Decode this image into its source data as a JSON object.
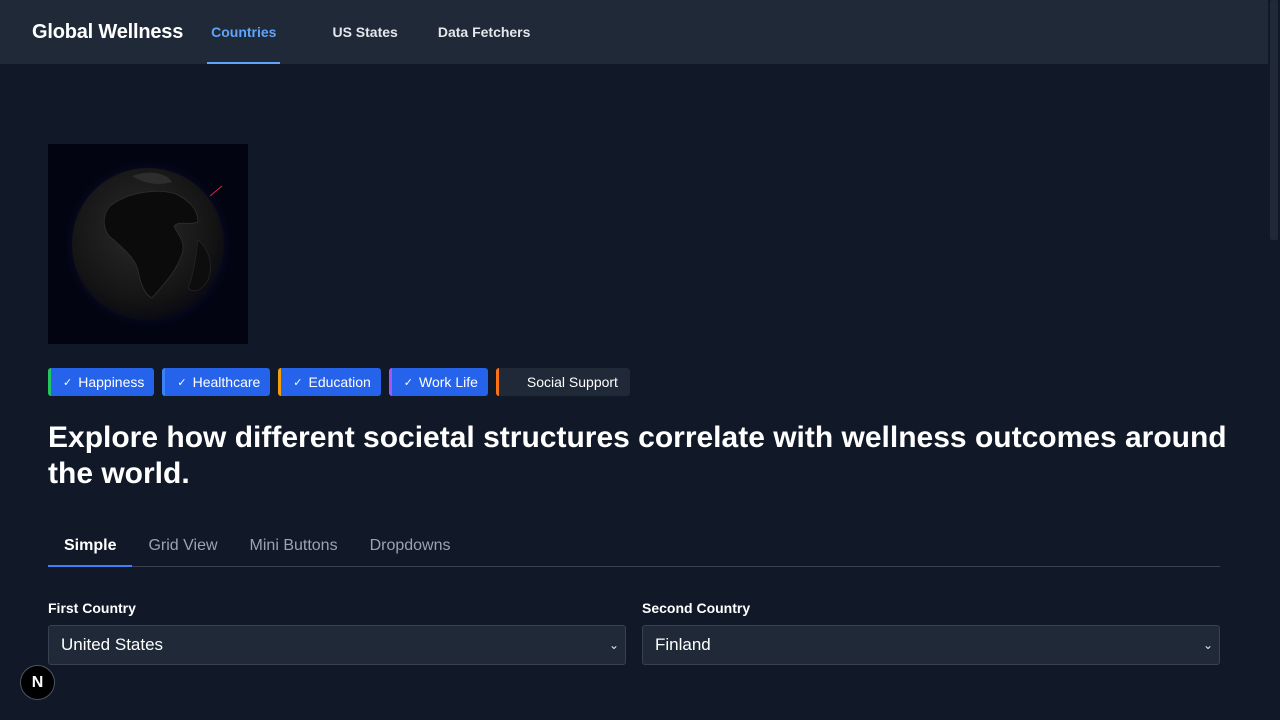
{
  "header": {
    "brand": "Global Wellness",
    "nav": [
      {
        "label": "Countries",
        "active": true
      },
      {
        "label": "US States",
        "active": false
      },
      {
        "label": "Data Fetchers",
        "active": false
      }
    ]
  },
  "metrics": [
    {
      "label": "Happiness",
      "checked": true,
      "check": "✓",
      "accent": "#22c55e"
    },
    {
      "label": "Healthcare",
      "checked": true,
      "check": "✓",
      "accent": "#3b82f6"
    },
    {
      "label": "Education",
      "checked": true,
      "check": "✓",
      "accent": "#f59e0b"
    },
    {
      "label": "Work Life",
      "checked": true,
      "check": "✓",
      "accent": "#a855f7"
    },
    {
      "label": "Social Support",
      "checked": false,
      "check": "",
      "accent": "#f97316"
    }
  ],
  "headline": "Explore how different societal structures correlate with wellness outcomes around the world.",
  "tabs": [
    {
      "label": "Simple",
      "active": true
    },
    {
      "label": "Grid View",
      "active": false
    },
    {
      "label": "Mini Buttons",
      "active": false
    },
    {
      "label": "Dropdowns",
      "active": false
    }
  ],
  "compare": {
    "first": {
      "label": "First Country",
      "value": "United States"
    },
    "second": {
      "label": "Second Country",
      "value": "Finland"
    }
  },
  "badge": {
    "label": "N"
  },
  "colors": {
    "background": "#111827",
    "nav_background": "#1f2937",
    "accent": "#60a5fa",
    "chip_active": "#2563eb"
  }
}
